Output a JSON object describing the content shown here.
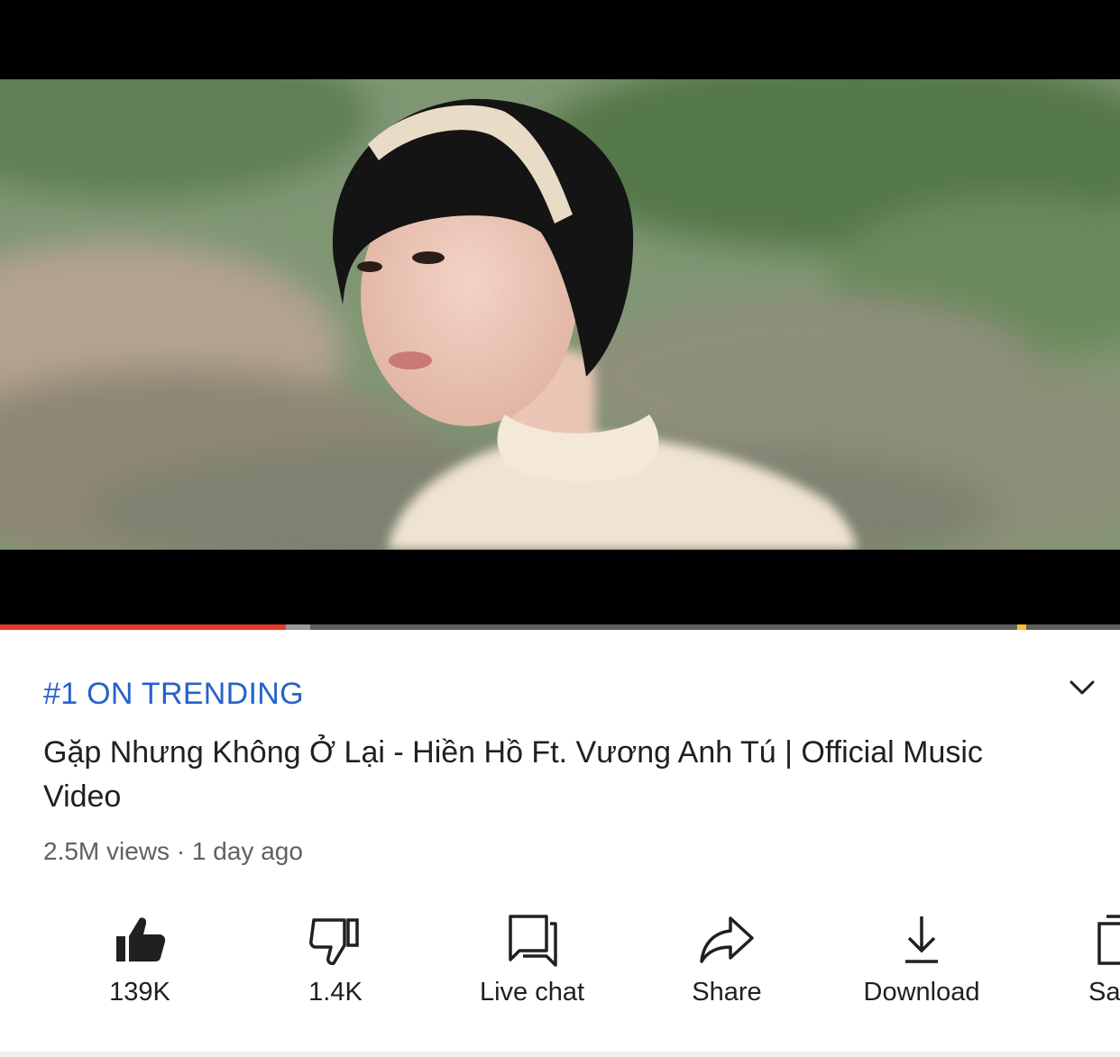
{
  "video": {
    "progress_played_fraction": 0.255,
    "progress_buffered_fraction": 0.277
  },
  "details": {
    "trending_badge": "#1 ON TRENDING",
    "title": "Gặp Nhưng Không Ở Lại - Hiền Hồ Ft. Vương Anh Tú | Official Music Video",
    "meta": "2.5M views · 1 day ago",
    "expand_icon": "chevron-down-icon"
  },
  "actions": [
    {
      "name": "like",
      "icon": "thumbs-up-icon",
      "label": "139K"
    },
    {
      "name": "dislike",
      "icon": "thumbs-down-icon",
      "label": "1.4K"
    },
    {
      "name": "live-chat",
      "icon": "chat-icon",
      "label": "Live chat"
    },
    {
      "name": "share",
      "icon": "share-icon",
      "label": "Share"
    },
    {
      "name": "download",
      "icon": "download-icon",
      "label": "Download"
    },
    {
      "name": "save",
      "icon": "save-icon",
      "label": "Sa"
    }
  ],
  "colors": {
    "trending": "#2662c9",
    "progress_played": "#e53b2f",
    "progress_marker": "#f2c230"
  }
}
